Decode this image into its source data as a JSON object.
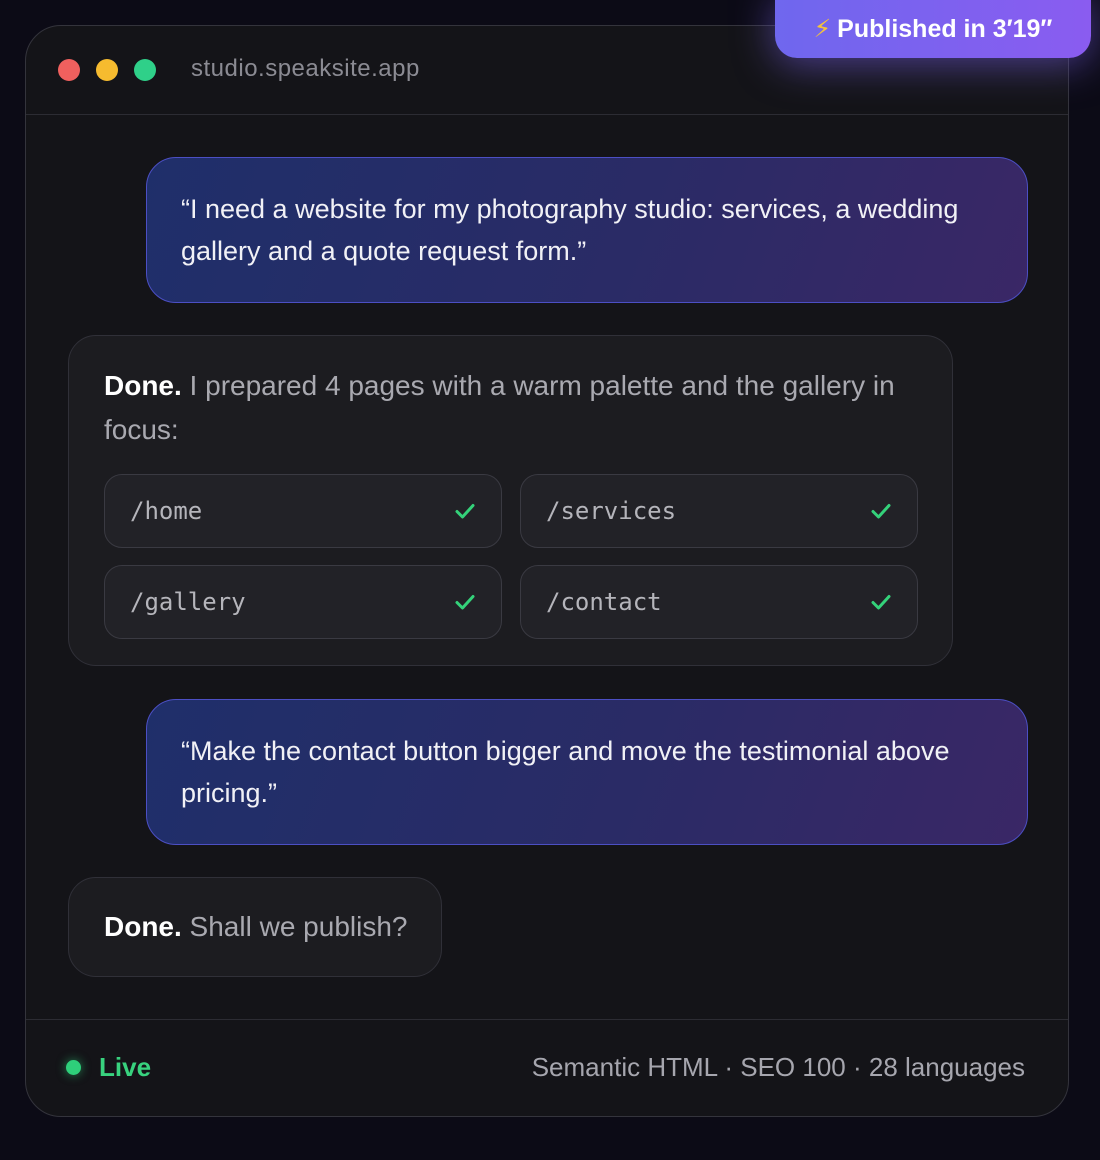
{
  "titlebar": {
    "url": "studio.speaksite.app"
  },
  "badge": {
    "icon": "lightning-icon",
    "text": "Published in 3′19″"
  },
  "messages": [
    {
      "role": "user",
      "text": "“I need a website for my photography studio: services, a wedding gallery and a quote request form.”"
    },
    {
      "role": "assistant",
      "lead": "Done.",
      "text": " I prepared 4 pages with a warm palette and the gallery in focus:",
      "routes": [
        {
          "path": "/home",
          "status": "check-icon"
        },
        {
          "path": "/services",
          "status": "check-icon"
        },
        {
          "path": "/gallery",
          "status": "check-icon"
        },
        {
          "path": "/contact",
          "status": "check-icon"
        }
      ]
    },
    {
      "role": "user",
      "text": "“Make the contact button bigger and move the testimonial above pricing.”"
    },
    {
      "role": "assistant",
      "lead": "Done.",
      "text": " Shall we publish?"
    }
  ],
  "footer": {
    "status": "Live",
    "meta": "Semantic HTML · SEO 100 · 28 languages"
  },
  "colors": {
    "accent": "#7b62f0",
    "success": "#2ecf7a",
    "check": "#34d27a"
  }
}
